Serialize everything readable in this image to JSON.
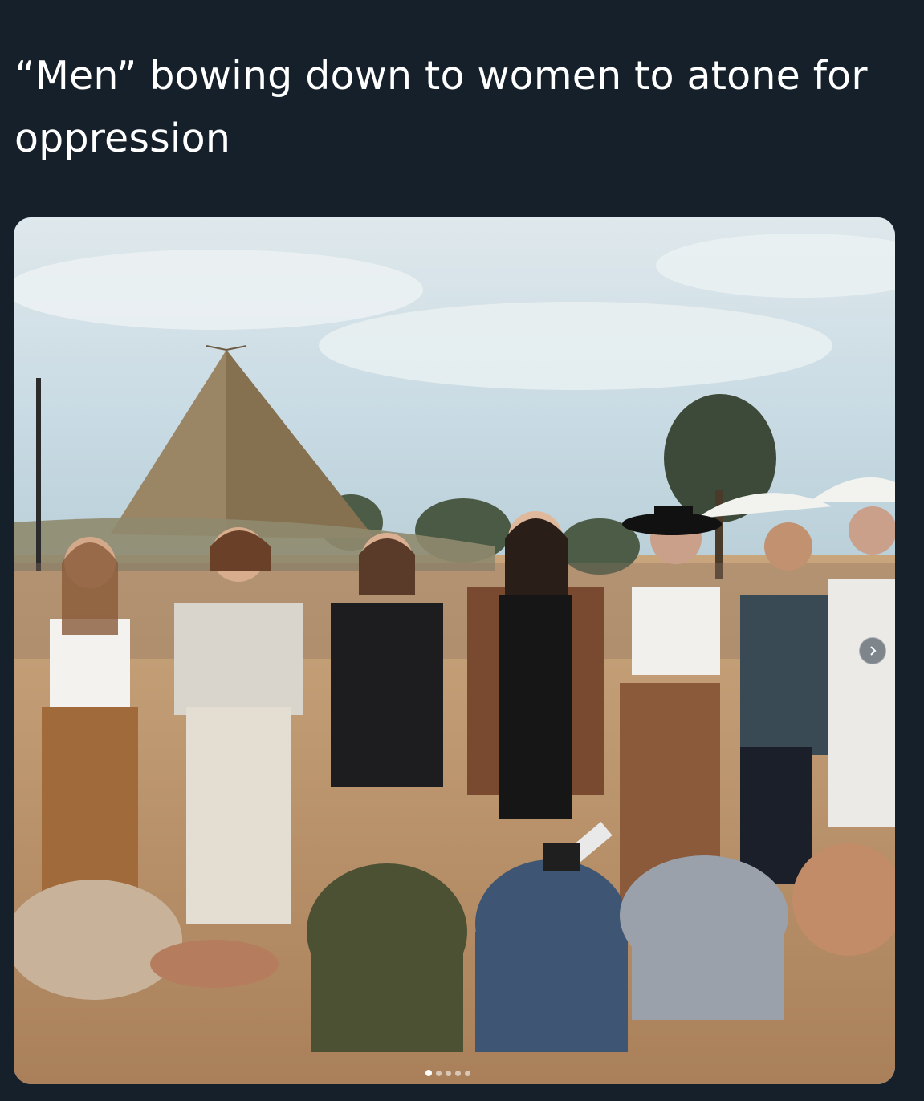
{
  "tweet": {
    "text": "“Men” bowing down to women to atone for oppression"
  },
  "media": {
    "image_alt": "Photo of women standing in a row with eyes closed while men kneel and bow before them at an outdoor gathering near a teepee",
    "carousel_position": 1,
    "carousel_total": 5,
    "next_icon": "chevron-right-icon"
  },
  "colors": {
    "background": "#15202b",
    "text": "#ffffff"
  }
}
